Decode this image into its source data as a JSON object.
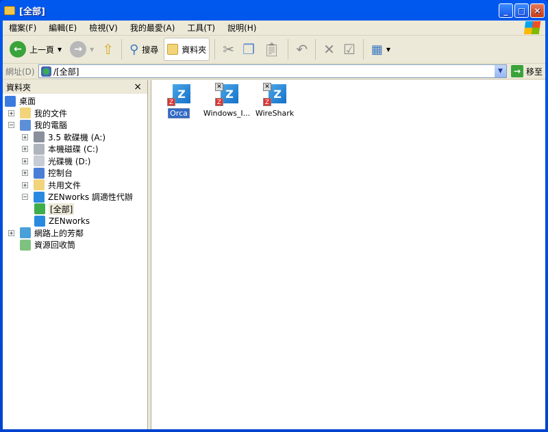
{
  "window": {
    "title": "[全部]"
  },
  "menu": [
    "檔案(F)",
    "編輯(E)",
    "檢視(V)",
    "我的最愛(A)",
    "工具(T)",
    "說明(H)"
  ],
  "toolbar": {
    "back": "上一頁",
    "search": "搜尋",
    "folders": "資料夾"
  },
  "address": {
    "label": "網址(D)",
    "value": "/[全部]",
    "go": "移至"
  },
  "folders_pane": {
    "title": "資料夾",
    "close": "×"
  },
  "tree": [
    {
      "label": "桌面",
      "level": 0,
      "expander": "",
      "color": "#3b7be0"
    },
    {
      "label": "我的文件",
      "level": 1,
      "expander": "+",
      "color": "#f2d47a"
    },
    {
      "label": "我的電腦",
      "level": 1,
      "expander": "−",
      "color": "#5c8fd8"
    },
    {
      "label": "3.5 軟碟機 (A:)",
      "level": 2,
      "expander": "+",
      "color": "#8a8f9c"
    },
    {
      "label": "本機磁碟 (C:)",
      "level": 2,
      "expander": "+",
      "color": "#b0b4bc"
    },
    {
      "label": "光碟機 (D:)",
      "level": 2,
      "expander": "+",
      "color": "#c8ccd4"
    },
    {
      "label": "控制台",
      "level": 2,
      "expander": "+",
      "color": "#4a7fd6"
    },
    {
      "label": "共用文件",
      "level": 2,
      "expander": "+",
      "color": "#f2d47a"
    },
    {
      "label": "ZENworks 調適性代辦",
      "level": 2,
      "expander": "−",
      "color": "#2a8ae0"
    },
    {
      "label": "[全部]",
      "level": 3,
      "expander": "",
      "color": "#3fae4a",
      "selected": true
    },
    {
      "label": "ZENworks",
      "level": 3,
      "expander": "",
      "color": "#2a8ae0"
    },
    {
      "label": "網路上的芳鄰",
      "level": 1,
      "expander": "+",
      "color": "#4aa0d8"
    },
    {
      "label": "資源回收筒",
      "level": 1,
      "expander": "",
      "color": "#7fc27f"
    }
  ],
  "items": [
    {
      "label": "Orca",
      "selected": true,
      "shortcut": false
    },
    {
      "label": "Windows_I...",
      "selected": false,
      "shortcut": true
    },
    {
      "label": "WireShark",
      "selected": false,
      "shortcut": true
    }
  ]
}
